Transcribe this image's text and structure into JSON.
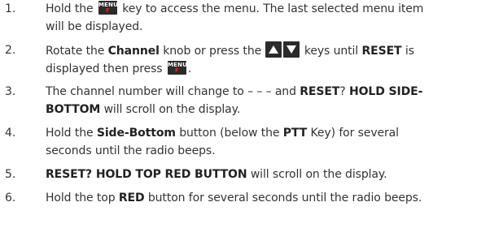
{
  "steps": [
    {
      "num": "1.",
      "l1_a": "Hold the ",
      "l1_b": " key to access the menu. The last selected menu item",
      "l2": "will be displayed."
    },
    {
      "num": "2.",
      "l1_a": "Rotate the ",
      "l1_b": "Channel",
      "l1_c": " knob or press the ",
      "l1_d": " keys until ",
      "l1_e": "RESET",
      "l1_f": " is",
      "l2_a": "displayed then press ",
      "l2_b": "."
    },
    {
      "num": "3.",
      "l1_a": "The channel number will change to – – – and ",
      "l1_b": "RESET",
      "l1_c": "? ",
      "l1_d": "HOLD SIDE-",
      "l2_a": "BOTTOM",
      "l2_b": " will scroll on the display."
    },
    {
      "num": "4.",
      "l1_a": "Hold the ",
      "l1_b": "Side-Bottom",
      "l1_c": " button (below the ",
      "l1_d": "PTT",
      "l1_e": " Key) for several",
      "l2": "seconds until the radio beeps."
    },
    {
      "num": "5.",
      "l1_a": "RESET? HOLD TOP RED BUTTON",
      "l1_b": " will scroll on the display."
    },
    {
      "num": "6.",
      "l1_a": "Hold the top ",
      "l1_b": "RED",
      "l1_c": " button for several seconds until the radio beeps."
    }
  ],
  "menu_key": {
    "top": "MENU",
    "bottom": "F"
  },
  "icons": {
    "menu_key": "menu-f-key-icon",
    "up_key": "up-arrow-key-icon",
    "down_key": "down-arrow-key-icon"
  },
  "colors": {
    "text": "#333333",
    "key_bg": "#2b2b2b",
    "key_label": "#ffffff",
    "key_accent": "#e0251b"
  }
}
